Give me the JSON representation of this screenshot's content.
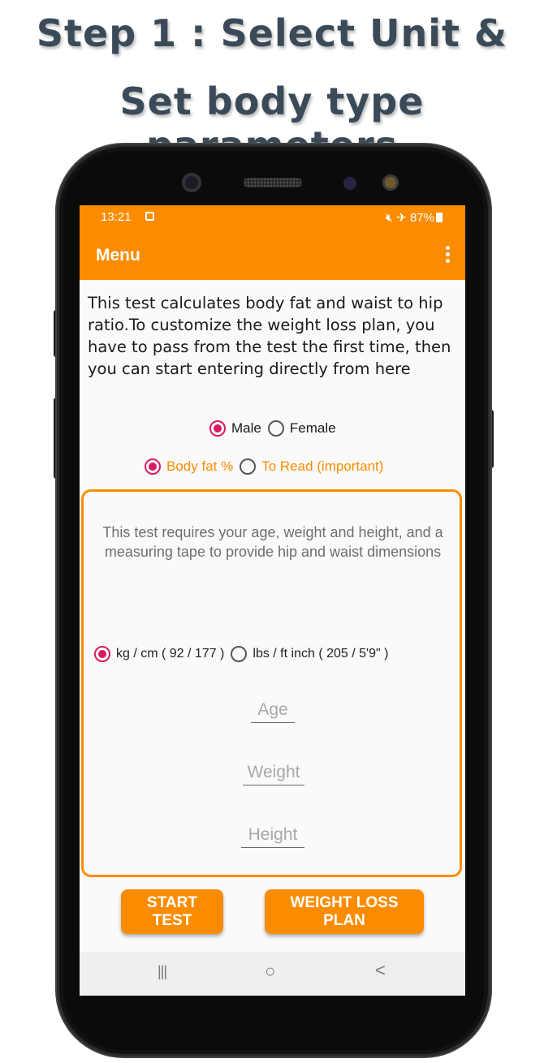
{
  "headline": {
    "line1": "Step 1 : Select Unit &",
    "line2": "Set body type parameters"
  },
  "status_bar": {
    "time": "13:21",
    "battery": "87%",
    "icons": [
      "sim-icon",
      "mute-icon",
      "airplane-icon",
      "battery-icon"
    ]
  },
  "app_bar": {
    "title": "Menu",
    "overflow_icon": "more-vert-icon"
  },
  "intro_text": "This test calculates body fat and waist to hip ratio.To customize the weight loss plan, you have to pass from the test the first time, then you can start entering directly from here",
  "gender": {
    "selected": "Male",
    "options": [
      "Male",
      "Female"
    ]
  },
  "mode": {
    "selected": "Body fat %",
    "options": [
      "Body fat %",
      "To Read (important)"
    ]
  },
  "card": {
    "description": "This test requires your age, weight and height, and a measuring tape to provide hip and waist dimensions",
    "units": {
      "selected": "kg / cm ( 92 / 177 )",
      "options": [
        "kg / cm ( 92 / 177 )",
        "lbs / ft inch ( 205 / 5'9\" )"
      ]
    },
    "fields": {
      "age_placeholder": "Age",
      "weight_placeholder": "Weight",
      "height_placeholder": "Height"
    }
  },
  "buttons": {
    "start_test": "START TEST",
    "weight_loss_plan": "WEIGHT LOSS PLAN"
  },
  "nav": {
    "recents": "|||",
    "home": "○",
    "back": "<"
  },
  "colors": {
    "accent": "#fb8c00",
    "radio_checked": "#d81b60",
    "headline": "#3a4a58"
  }
}
